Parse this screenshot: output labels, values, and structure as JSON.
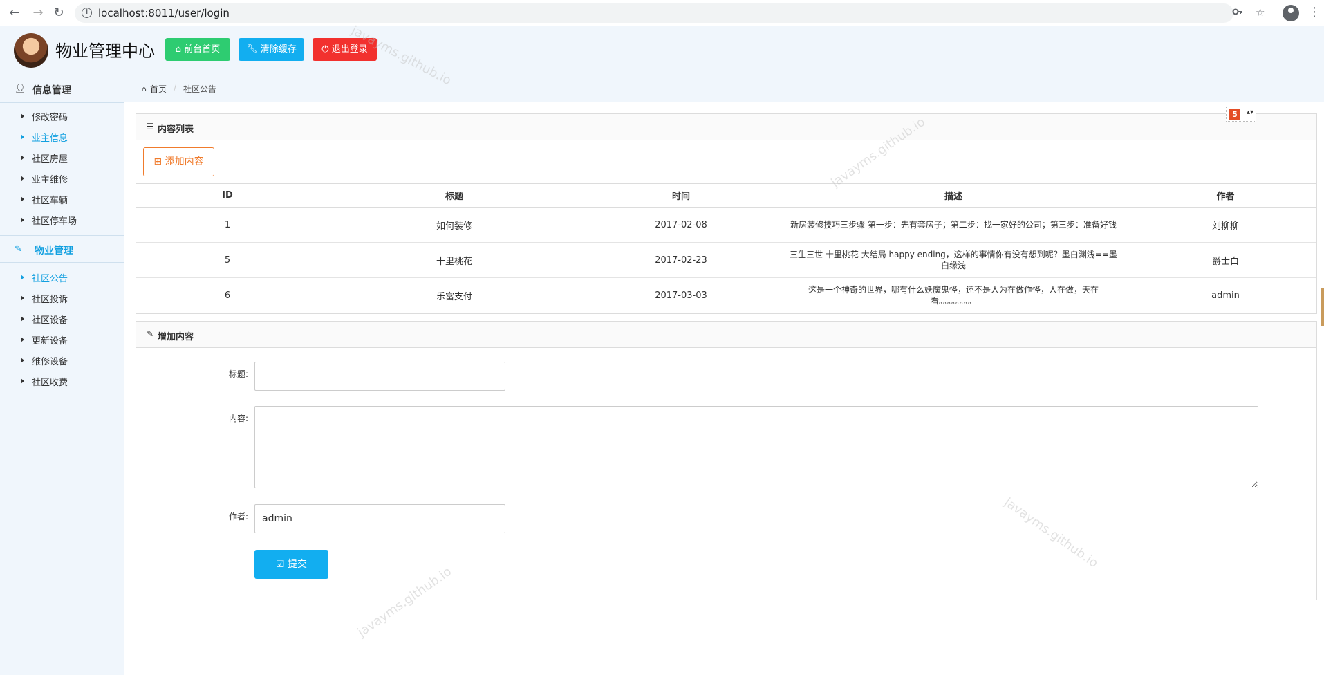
{
  "browser": {
    "back": "←",
    "forward": "→",
    "reload": "↻",
    "url": "localhost:8011/user/login",
    "key_icon": "key-icon",
    "star_icon": "star-icon"
  },
  "header": {
    "title": "物业管理中心",
    "buttons": {
      "home": "前台首页",
      "clear_cache": "清除缓存",
      "logout": "退出登录"
    }
  },
  "sidebar": {
    "sections": [
      {
        "label": "信息管理",
        "items": [
          "修改密码",
          "业主信息",
          "社区房屋",
          "业主维修",
          "社区车辆",
          "社区停车场"
        ]
      },
      {
        "label": "物业管理",
        "items": [
          "社区公告",
          "社区投诉",
          "社区设备",
          "更新设备",
          "维修设备",
          "社区收费"
        ]
      }
    ]
  },
  "breadcrumb": {
    "home": "首页",
    "sep": "/",
    "current": "社区公告"
  },
  "list_panel": {
    "title": "内容列表",
    "add_button": "添加内容",
    "columns": [
      "ID",
      "标题",
      "时间",
      "描述",
      "作者"
    ],
    "rows": [
      [
        "1",
        "如何装修",
        "2017-02-08",
        "新房装修技巧三步骤 第一步：先有套房子；第二步：找一家好的公司；第三步：准备好钱",
        "刘柳柳"
      ],
      [
        "5",
        "十里桃花",
        "2017-02-23",
        "三生三世 十里桃花 大结局 happy ending，这样的事情你有没有想到呢？墨白渊浅==墨白缘浅",
        "爵士白"
      ],
      [
        "6",
        "乐富支付",
        "2017-03-03",
        "这是一个神奇的世界，哪有什么妖魔鬼怪，还不是人为在做作怪，人在做，天在看。。。。。。。。",
        "admin"
      ]
    ]
  },
  "form_panel": {
    "title": "增加内容",
    "title_label": "标题:",
    "title_value": "",
    "content_label": "内容:",
    "content_value": "",
    "author_label": "作者:",
    "author_value": "admin",
    "submit": "提交"
  },
  "watermark": "javayms.github.io",
  "float_widget": {
    "badge": "5",
    "caret": "▴▾"
  }
}
